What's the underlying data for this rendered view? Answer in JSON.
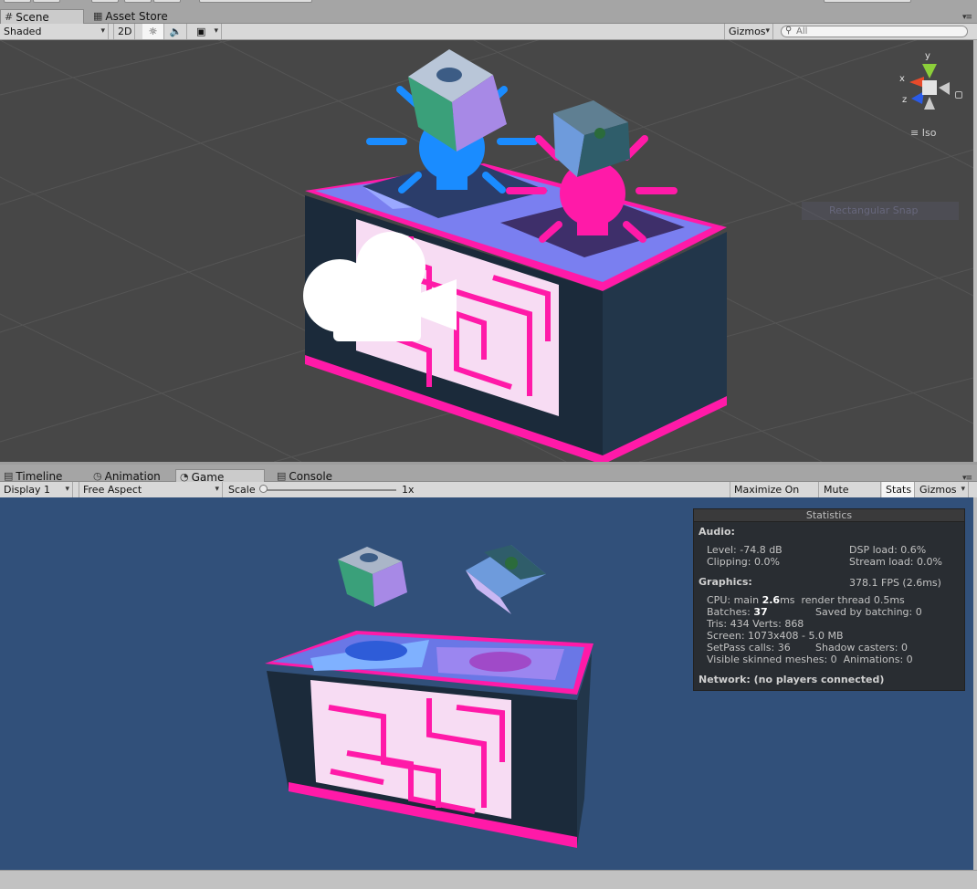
{
  "scene_tabs": [
    {
      "label": "Scene",
      "icon": "grid-icon",
      "active": true
    },
    {
      "label": "Asset Store",
      "icon": "store-icon",
      "active": false
    }
  ],
  "scene_toolbar": {
    "shading_mode": "Shaded",
    "mode_2d": "2D",
    "gizmos": "Gizmos",
    "search_placeholder": "All"
  },
  "scene_view": {
    "projection": "Iso",
    "axis_labels": {
      "x": "x",
      "y": "y",
      "z": "z"
    },
    "overlay_text": "Rectangular Snap"
  },
  "bottom_tabs": [
    {
      "label": "Timeline",
      "icon": "timeline-icon",
      "active": false
    },
    {
      "label": "Animation",
      "icon": "clock-icon",
      "active": false
    },
    {
      "label": "Game",
      "icon": "pacman-icon",
      "active": true
    },
    {
      "label": "Console",
      "icon": "console-icon",
      "active": false
    }
  ],
  "game_toolbar": {
    "display": "Display 1",
    "aspect": "Free Aspect",
    "scale_label": "Scale",
    "scale_value": "1x",
    "maximize_on_play": "Maximize On Play",
    "mute_audio": "Mute Audio",
    "stats": "Stats",
    "gizmos": "Gizmos"
  },
  "statistics": {
    "title": "Statistics",
    "audio_header": "Audio:",
    "level": "Level: -74.8 dB",
    "dsp_load": "DSP load: 0.6%",
    "clipping": "Clipping: 0.0%",
    "stream_load": "Stream load: 0.0%",
    "graphics_header": "Graphics:",
    "fps": "378.1 FPS (2.6ms)",
    "cpu_prefix": "CPU: main ",
    "cpu_main": "2.6",
    "cpu_suffix": "ms  render thread 0.5ms",
    "batches_prefix": "Batches: ",
    "batches": "37",
    "saved_by_batching": "Saved by batching: 0",
    "tris_verts": "Tris: 434 Verts: 868",
    "screen": "Screen: 1073x408 - 5.0 MB",
    "setpass": "SetPass calls: 36",
    "shadow_casters": "Shadow casters: 0",
    "skinned": "Visible skinned meshes: 0  Animations: 0",
    "network": "Network: (no players connected)"
  },
  "colors": {
    "scene_bg": "#474747",
    "game_bg": "#31507a",
    "neon_pink": "#ff1aa8",
    "neon_blue": "#1a8cff",
    "cabinet_dark": "#1b2a3a"
  }
}
